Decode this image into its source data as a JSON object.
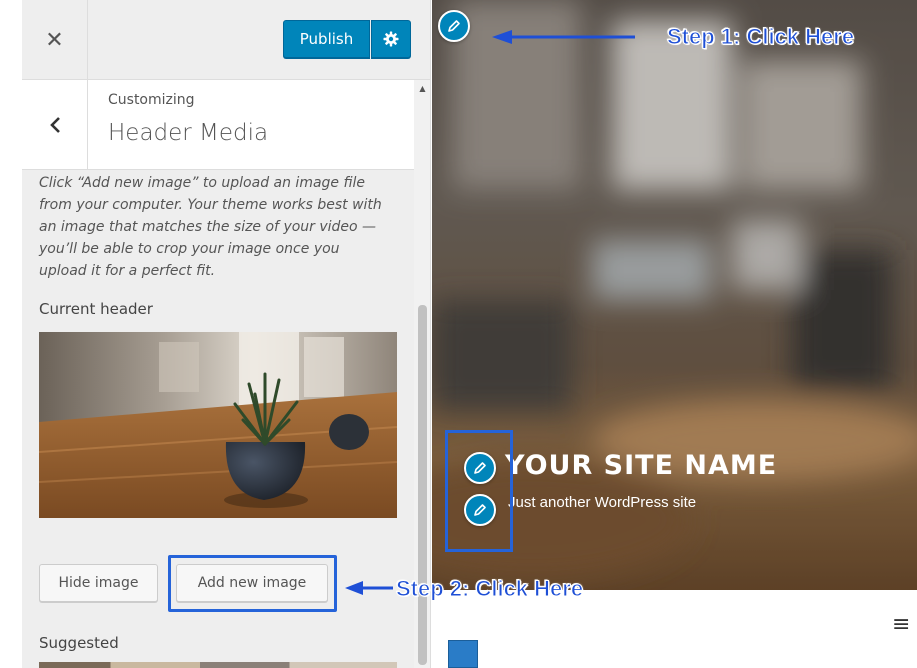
{
  "customizer": {
    "close_icon": "close-icon",
    "publish_label": "Publish",
    "settings_icon": "gear-icon",
    "back_icon": "chevron-left-icon",
    "breadcrumb": "Customizing",
    "section_title": "Header Media",
    "description": "Click “Add new image” to upload an image file from your computer. Your theme works best with an image that matches the size of your video — you’ll be able to crop your image once you upload it for a perfect fit.",
    "current_header_label": "Current header",
    "current_header_image": "plant-on-table-photo",
    "hide_image_label": "Hide image",
    "add_new_image_label": "Add new image",
    "suggested_label": "Suggested"
  },
  "preview": {
    "site_name": "YOUR SITE NAME",
    "tagline": "Just another WordPress site",
    "edit_icon": "pencil-icon",
    "menu_icon": "hamburger-menu-icon"
  },
  "annotations": {
    "step1": "Step 1: Click Here",
    "step2": "Step 2: Click Here",
    "color": "#1e4fd6"
  },
  "colors": {
    "publish_blue": "#0085ba",
    "highlight_blue": "#2563d9",
    "panel_bg": "#eeeeee"
  }
}
